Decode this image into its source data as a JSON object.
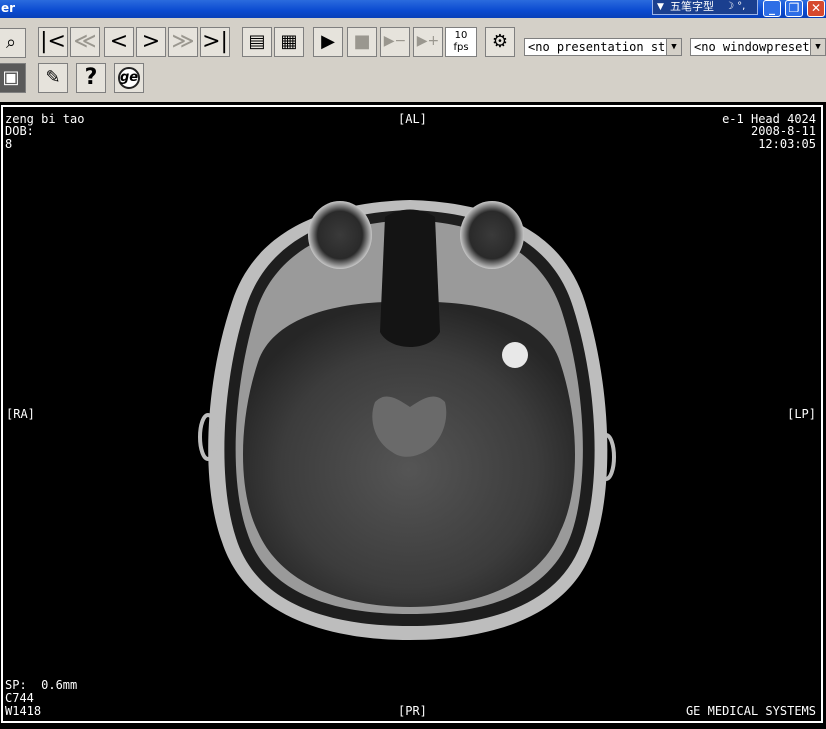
{
  "window": {
    "title": "er",
    "ime_label": "五笔字型",
    "ime_symbols": "☽ °,"
  },
  "toolbar": {
    "fps_value": "10",
    "fps_unit": "fps",
    "presentation_state": "<no presentation st",
    "window_preset": "<no windowpreset>"
  },
  "overlay": {
    "patient_name": "zeng bi tao",
    "dob_label": "DOB:",
    "image_number": "8",
    "top_orientation": "[AL]",
    "series": "e-1 Head 4024",
    "date": "2008-8-11",
    "time": "12:03:05",
    "left_orientation": "[RA]",
    "right_orientation": "[LP]",
    "spacing": "SP:  0.6mm",
    "window_center": "C744",
    "window_width": "W1418",
    "bottom_orientation": "[PR]",
    "manufacturer": "GE MEDICAL SYSTEMS"
  },
  "colors": {
    "titlebar": "#0a4ad0",
    "toolbar_bg": "#d4d0c8",
    "viewer_bg": "#000000",
    "overlay_text": "#ffffff"
  }
}
